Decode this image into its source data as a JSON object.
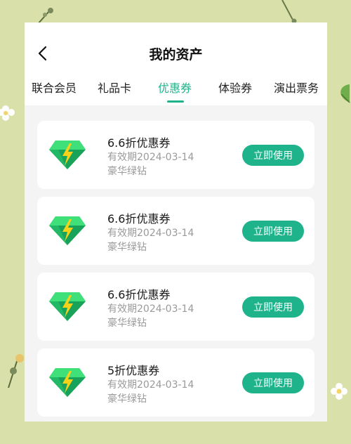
{
  "header": {
    "title": "我的资产",
    "back_icon": "chevron-left-icon"
  },
  "tabs": [
    {
      "label": "联合会员",
      "active": false
    },
    {
      "label": "礼品卡",
      "active": false
    },
    {
      "label": "优惠券",
      "active": true
    },
    {
      "label": "体验券",
      "active": false
    },
    {
      "label": "演出票务",
      "active": false
    }
  ],
  "coupons": [
    {
      "title": "6.6折优惠券",
      "expiry": "有效期2024-03-14",
      "subtitle": "豪华绿钻",
      "button": "立即使用",
      "icon": "green-diamond-icon"
    },
    {
      "title": "6.6折优惠券",
      "expiry": "有效期2024-03-14",
      "subtitle": "豪华绿钻",
      "button": "立即使用",
      "icon": "green-diamond-icon"
    },
    {
      "title": "6.6折优惠券",
      "expiry": "有效期2024-03-14",
      "subtitle": "豪华绿钻",
      "button": "立即使用",
      "icon": "green-diamond-icon"
    },
    {
      "title": "5折优惠券",
      "expiry": "有效期2024-03-14",
      "subtitle": "豪华绿钻",
      "button": "立即使用",
      "icon": "green-diamond-icon"
    }
  ],
  "colors": {
    "accent": "#1fb38b",
    "background": "#d9e0a9",
    "card": "#ffffff",
    "muted_text": "#9a9a9a",
    "gem_light": "#3fe07a",
    "gem_dark": "#19a35a",
    "bolt": "#f5d21a"
  }
}
